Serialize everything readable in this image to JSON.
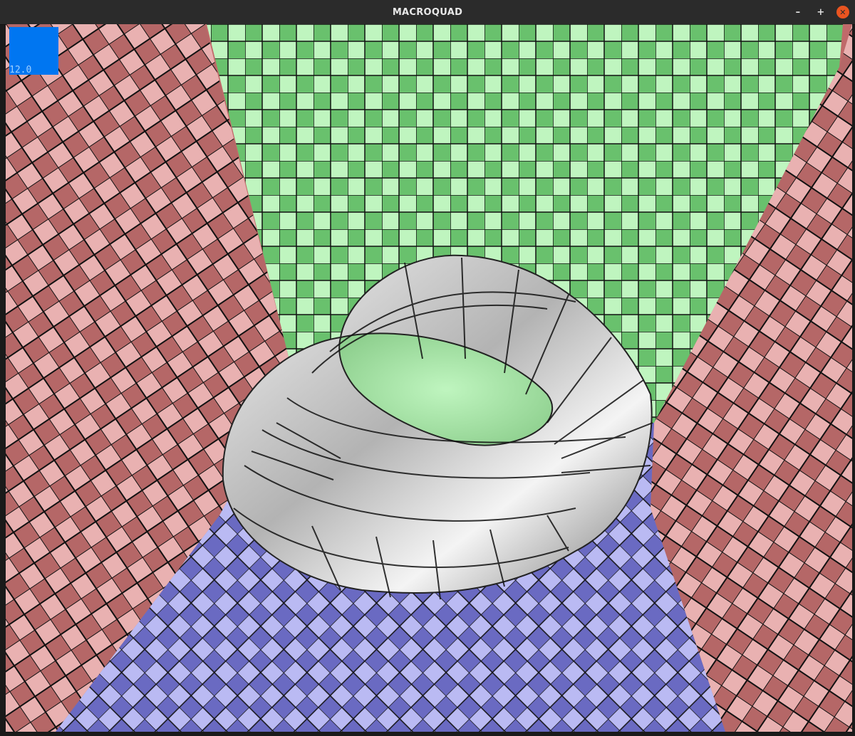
{
  "window": {
    "title": "MACROQUAD",
    "controls": {
      "minimize": "–",
      "maximize": "+",
      "close": "✕"
    }
  },
  "hud": {
    "value": "12.0",
    "box_color": "#0076f1"
  },
  "scene": {
    "wall_colors": {
      "light": "#e9b1b1",
      "dark": "#b56767"
    },
    "back_colors": {
      "light": "#bff5bf",
      "dark": "#69c16d"
    },
    "floor_colors": {
      "light": "#babaf3",
      "dark": "#6a6ac2"
    },
    "object": "mobius-strip",
    "object_colors": {
      "light": "#f4f4f4",
      "mid": "#b3b3b3",
      "dark": "#787878"
    }
  }
}
